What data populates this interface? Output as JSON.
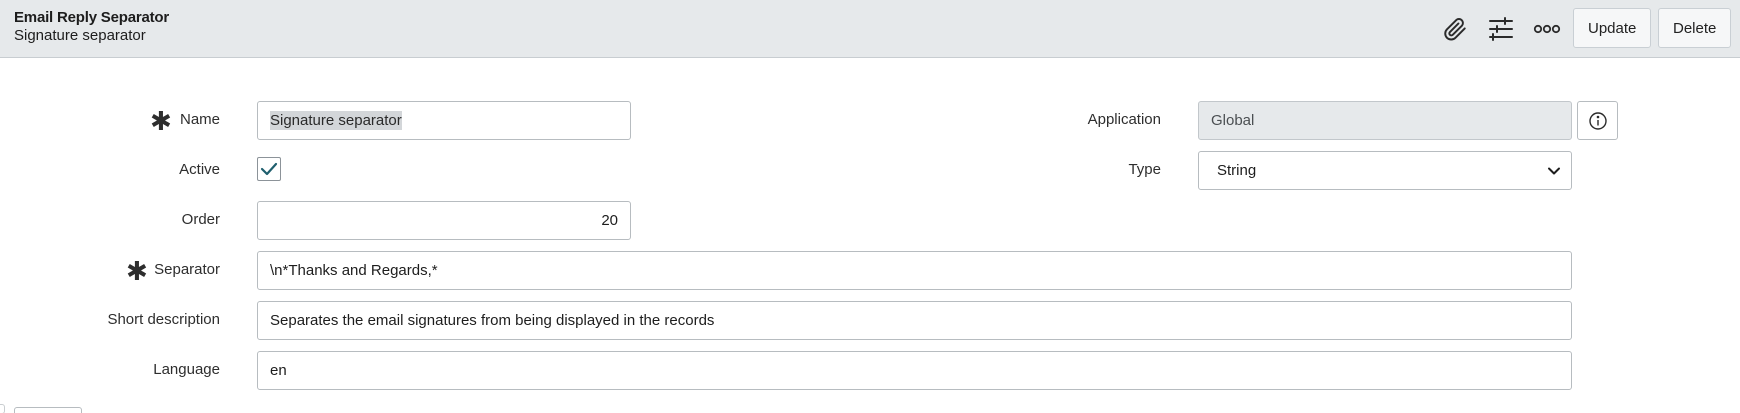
{
  "header": {
    "title": "Email Reply Separator",
    "subtitle": "Signature separator",
    "icons": [
      "paperclip-icon",
      "sliders-icon",
      "more-options-icon"
    ],
    "update_label": "Update",
    "delete_label": "Delete"
  },
  "form": {
    "name": {
      "label": "Name",
      "value": "Signature separator",
      "required": true
    },
    "active": {
      "label": "Active",
      "checked": true
    },
    "order": {
      "label": "Order",
      "value": "20"
    },
    "separator": {
      "label": "Separator",
      "value": "\\n*Thanks and Regards,*",
      "required": true
    },
    "short_description": {
      "label": "Short description",
      "value": "Separates the email signatures from being displayed in the records"
    },
    "language": {
      "label": "Language",
      "value": "en"
    },
    "application": {
      "label": "Application",
      "value": "Global"
    },
    "type": {
      "label": "Type",
      "value": "String"
    }
  },
  "colors": {
    "header_bg": "#e6e9eb",
    "checkmark": "#1f5f6e",
    "readonly_bg": "#e6e9eb"
  }
}
